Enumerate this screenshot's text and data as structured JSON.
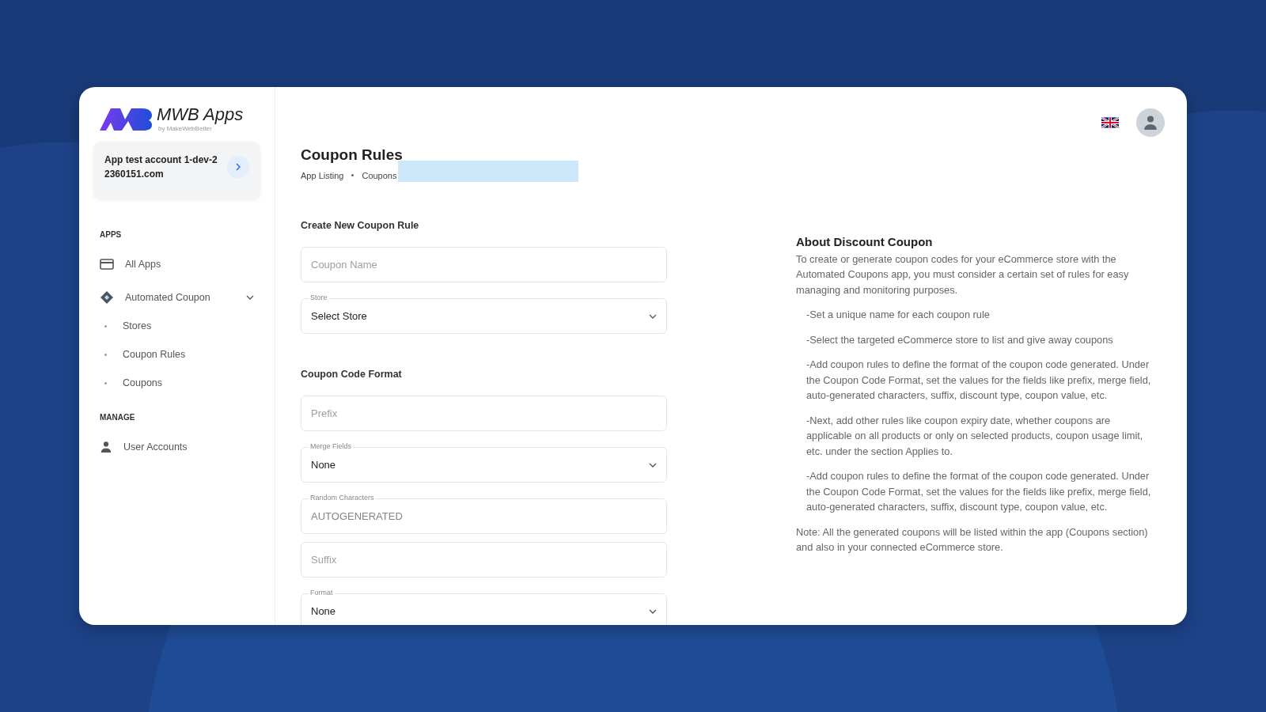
{
  "brand": {
    "name": "MWB Apps",
    "tagline": "by MakeWebBetter"
  },
  "account": {
    "name": "App test account 1-dev-2 2360151.com"
  },
  "sidebar": {
    "sections": [
      {
        "heading": "APPS",
        "items": [
          {
            "label": "All Apps",
            "kind": "apps"
          },
          {
            "label": "Automated Coupon",
            "kind": "app",
            "expanded": true,
            "children": [
              {
                "label": "Stores"
              },
              {
                "label": "Coupon Rules"
              },
              {
                "label": "Coupons"
              }
            ]
          }
        ]
      },
      {
        "heading": "MANAGE",
        "items": [
          {
            "label": "User Accounts",
            "kind": "users"
          }
        ]
      }
    ]
  },
  "page": {
    "title": "Coupon Rules",
    "breadcrumbs": [
      "App Listing",
      "Coupons"
    ]
  },
  "form": {
    "sections": [
      {
        "heading": "Create New Coupon Rule",
        "fields": [
          {
            "kind": "input",
            "placeholder": "Coupon Name"
          },
          {
            "kind": "select",
            "label": "Store",
            "value": "Select Store"
          }
        ]
      },
      {
        "heading": "Coupon Code Format",
        "fields": [
          {
            "kind": "input",
            "placeholder": "Prefix"
          },
          {
            "kind": "select",
            "label": "Merge Fields",
            "value": "None"
          },
          {
            "kind": "input",
            "label": "Random Characters",
            "value": "AUTOGENERATED",
            "disabled": true
          },
          {
            "kind": "input",
            "placeholder": "Suffix"
          },
          {
            "kind": "select",
            "label": "Format",
            "value": "None"
          }
        ]
      }
    ]
  },
  "about": {
    "title": "About Discount Coupon",
    "intro": "To create or generate coupon codes for your eCommerce store with the Automated Coupons app, you must consider a certain set of rules for easy managing and monitoring purposes.",
    "points": [
      "-Set a unique name for each coupon rule",
      "-Select the targeted eCommerce store to list and give away coupons",
      "-Add coupon rules to define the format of the coupon code generated. Under the Coupon Code Format, set the values for the fields like prefix, merge field, auto-generated characters, suffix, discount type, coupon value, etc.",
      "-Next, add other rules like coupon expiry date, whether coupons are applicable on all products or only on selected products, coupon usage limit, etc. under the section Applies to.",
      "-Add coupon rules to define the format of the coupon code generated. Under the Coupon Code Format, set the values for the fields like prefix, merge field, auto-generated characters, suffix, discount type, coupon value, etc."
    ],
    "note": "Note: All the generated coupons will be listed within the app (Coupons section) and also in your connected eCommerce store."
  }
}
